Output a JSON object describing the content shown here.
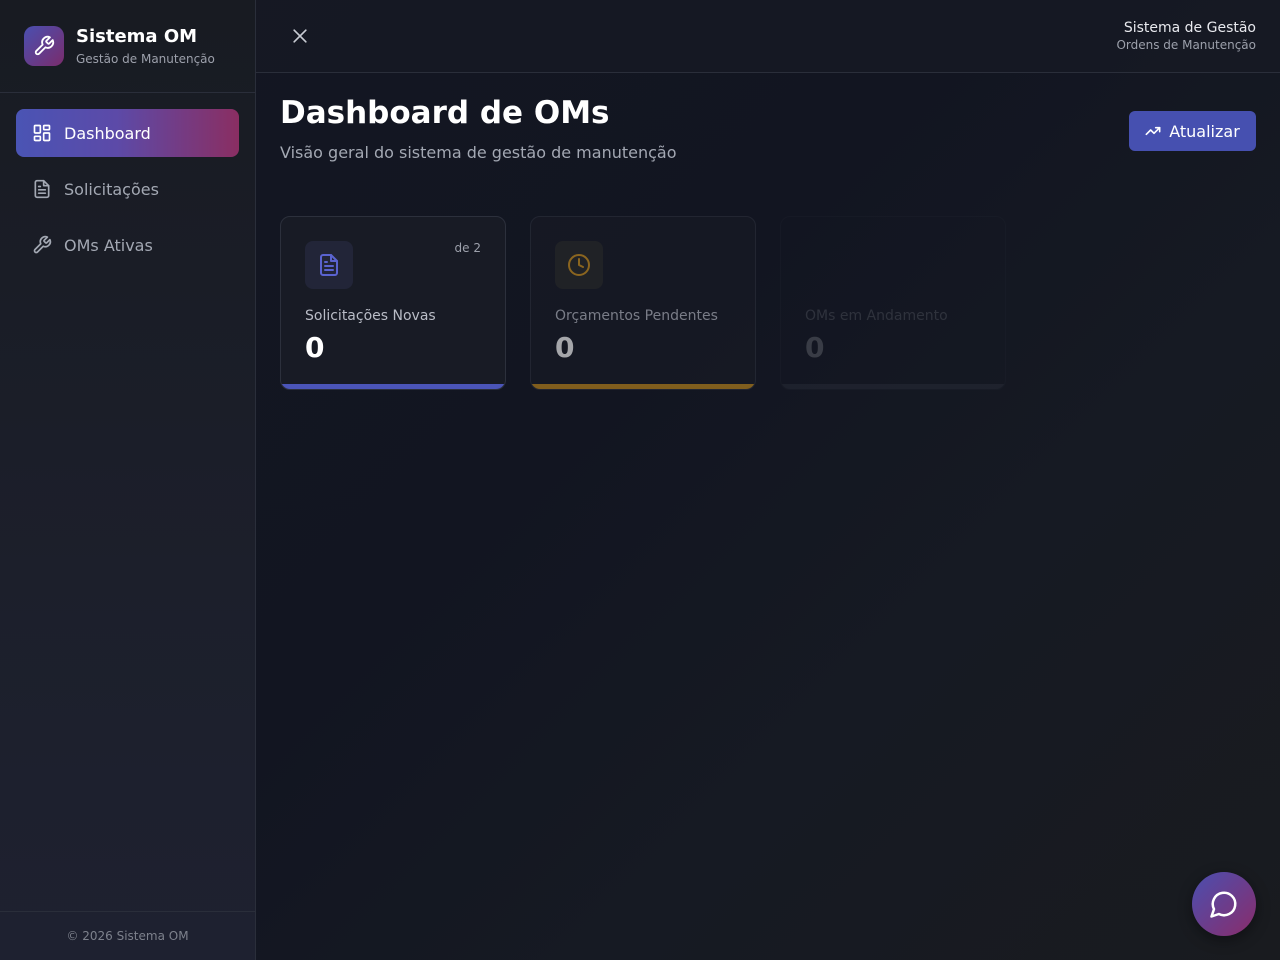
{
  "sidebar": {
    "brand": {
      "title": "Sistema OM",
      "subtitle": "Gestão de Manutenção",
      "icon": "wrench-icon"
    },
    "items": [
      {
        "label": "Dashboard",
        "icon": "dashboard-grid-icon",
        "active": true
      },
      {
        "label": "Solicitações",
        "icon": "document-icon",
        "active": false
      },
      {
        "label": "OMs Ativas",
        "icon": "wrench-icon",
        "active": false
      }
    ],
    "footer": "© 2026 Sistema OM"
  },
  "header": {
    "close_icon": "close-icon",
    "title": "Sistema de Gestão",
    "subtitle": "Ordens de Manutenção"
  },
  "main": {
    "title": "Dashboard de OMs",
    "subtitle": "Visão geral do sistema de gestão de manutenção",
    "refresh_button": {
      "label": "Atualizar",
      "icon": "trending-up-icon"
    },
    "cards": [
      {
        "label": "Solicitações Novas",
        "value": "0",
        "badge": "de 2",
        "icon": "document-icon",
        "accent": "#4b55b8"
      },
      {
        "label": "Orçamentos Pendentes",
        "value": "0",
        "icon": "clock-icon",
        "accent": "#c48a1c"
      },
      {
        "label": "OMs em Andamento",
        "value": "0",
        "accent": "#555a66"
      }
    ]
  },
  "chat_button": {
    "icon": "chat-bubble-icon"
  },
  "colors": {
    "accent": "#4650b0",
    "brand_gradient_end": "#8a2c6a",
    "warning": "#c48a1c",
    "background": "#141722"
  }
}
